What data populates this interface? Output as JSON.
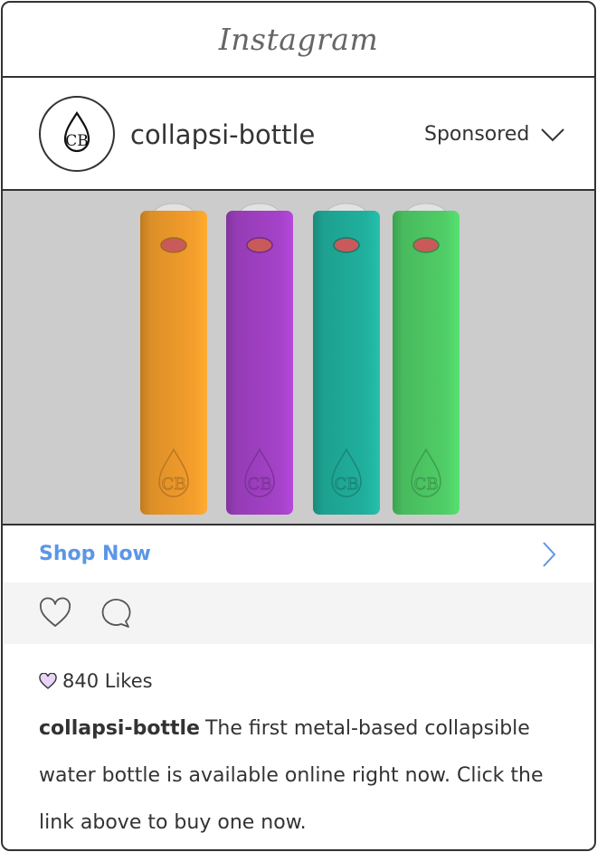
{
  "app": {
    "name": "Instagram"
  },
  "post": {
    "username": "collapsi-bottle",
    "sponsored_label": "Sponsored",
    "avatar_text": "CB"
  },
  "media": {
    "background": "#cccccc",
    "bottles": [
      {
        "color": "#e8962a",
        "logo": "CB"
      },
      {
        "color": "#9d3fbf",
        "logo": "CB"
      },
      {
        "color": "#1fa896",
        "logo": "CB"
      },
      {
        "color": "#4cc462",
        "logo": "CB"
      }
    ]
  },
  "cta": {
    "label": "Shop Now",
    "color": "#5b96e6"
  },
  "actions": {
    "like_icon": "heart-icon",
    "comment_icon": "comment-icon"
  },
  "likes": {
    "text": "840 Likes",
    "icon_color": "#e8d4f7"
  },
  "caption": {
    "username": "collapsi-bottle",
    "text": "The first metal-based collapsible water bottle is available online right now. Click the link above to buy one now."
  }
}
